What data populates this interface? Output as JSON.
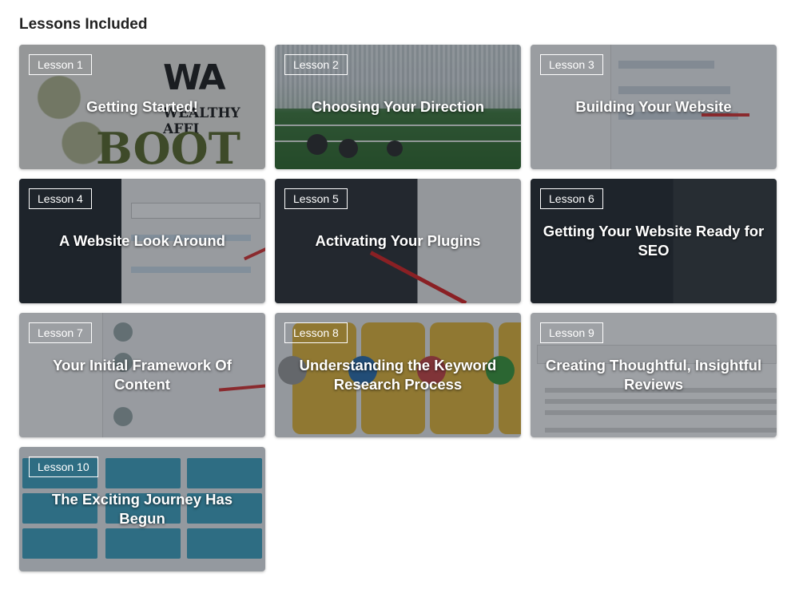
{
  "section": {
    "title": "Lessons Included"
  },
  "lessons": [
    {
      "badge": "Lesson 1",
      "title": "Getting Started!"
    },
    {
      "badge": "Lesson 2",
      "title": "Choosing Your Direction"
    },
    {
      "badge": "Lesson 3",
      "title": "Building Your Website"
    },
    {
      "badge": "Lesson 4",
      "title": "A Website Look Around"
    },
    {
      "badge": "Lesson 5",
      "title": "Activating Your Plugins"
    },
    {
      "badge": "Lesson 6",
      "title": "Getting Your Website Ready for SEO"
    },
    {
      "badge": "Lesson 7",
      "title": "Your Initial Framework Of Content"
    },
    {
      "badge": "Lesson 8",
      "title": "Understanding the Keyword Research Process"
    },
    {
      "badge": "Lesson 9",
      "title": "Creating Thoughtful, Insightful Reviews"
    },
    {
      "badge": "Lesson 10",
      "title": "The Exciting Journey Has Begun"
    }
  ],
  "colors": {
    "overlay": "#191e28",
    "badge_border": "#ffffff",
    "title_text": "#ffffff",
    "page_background": "#ffffff"
  }
}
